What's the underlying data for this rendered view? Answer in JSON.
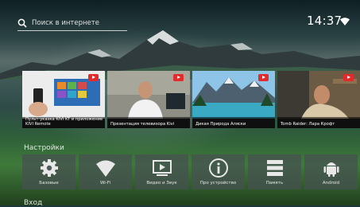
{
  "search": {
    "placeholder": "Поиск в интернете"
  },
  "status": {
    "time": "14:37"
  },
  "videos": [
    {
      "title": "Пульт-указка KIVI KT и приложение KIVI Remote"
    },
    {
      "title": "Презентация телевизора Kivi"
    },
    {
      "title": "Дикая Природа Аляски"
    },
    {
      "title": "Tomb Raider: Лара Крофт"
    }
  ],
  "sections": {
    "settings": "Настройки",
    "apps": "Вход"
  },
  "settings_tiles": [
    {
      "label": "Базовые",
      "icon": "gear-icon"
    },
    {
      "label": "Wi-Fi",
      "icon": "wifi-icon"
    },
    {
      "label": "Видео и Звук",
      "icon": "video-icon"
    },
    {
      "label": "Про устройство",
      "icon": "info-icon"
    },
    {
      "label": "Память",
      "icon": "storage-icon"
    },
    {
      "label": "Android",
      "icon": "android-icon"
    }
  ],
  "colors": {
    "youtube_red": "#e32b2b",
    "tile_bg": "#465052"
  }
}
